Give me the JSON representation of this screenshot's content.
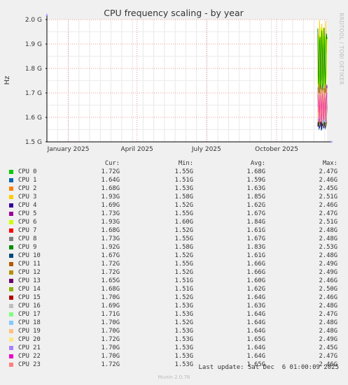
{
  "graph": {
    "side_label": "RRDTOOL / TOBI OETIKER",
    "last_update": "Last update: Sat Dec  6 01:00:09 2025",
    "footer": "Munin 2.0.76"
  },
  "chart_data": {
    "type": "line",
    "title": "CPU frequency scaling - by year",
    "ylabel": "Hz",
    "ylim": [
      1.5,
      2.0
    ],
    "yticks": [
      {
        "value": 2.0,
        "label": "2.0 G"
      },
      {
        "value": 1.9,
        "label": "1.9 G"
      },
      {
        "value": 1.8,
        "label": "1.8 G"
      },
      {
        "value": 1.7,
        "label": "1.7 G"
      },
      {
        "value": 1.6,
        "label": "1.6 G"
      },
      {
        "value": 1.5,
        "label": "1.5 G"
      }
    ],
    "xlim": [
      "2024-12-04",
      "2025-12-06"
    ],
    "xticks": [
      {
        "date": "2025-01-01",
        "label": "January 2025"
      },
      {
        "date": "2025-04-01",
        "label": "April 2025"
      },
      {
        "date": "2025-07-01",
        "label": "July 2025"
      },
      {
        "date": "2025-10-01",
        "label": "October 2025"
      }
    ],
    "data_start": "2025-11-24",
    "grid": true,
    "legend_headers": [
      "Cur:",
      "Min:",
      "Avg:",
      "Max:"
    ],
    "series": [
      {
        "name": "CPU 0",
        "color": "#00cc00",
        "cur": "1.72G",
        "min": "1.55G",
        "avg": "1.68G",
        "max": "2.47G"
      },
      {
        "name": "CPU 1",
        "color": "#0066b3",
        "cur": "1.64G",
        "min": "1.51G",
        "avg": "1.59G",
        "max": "2.46G"
      },
      {
        "name": "CPU 2",
        "color": "#ff8000",
        "cur": "1.68G",
        "min": "1.53G",
        "avg": "1.63G",
        "max": "2.45G"
      },
      {
        "name": "CPU 3",
        "color": "#ffcc00",
        "cur": "1.93G",
        "min": "1.58G",
        "avg": "1.85G",
        "max": "2.51G"
      },
      {
        "name": "CPU 4",
        "color": "#330099",
        "cur": "1.69G",
        "min": "1.52G",
        "avg": "1.62G",
        "max": "2.46G"
      },
      {
        "name": "CPU 5",
        "color": "#990099",
        "cur": "1.73G",
        "min": "1.55G",
        "avg": "1.67G",
        "max": "2.47G"
      },
      {
        "name": "CPU 6",
        "color": "#ccff00",
        "cur": "1.93G",
        "min": "1.60G",
        "avg": "1.84G",
        "max": "2.51G"
      },
      {
        "name": "CPU 7",
        "color": "#ff0000",
        "cur": "1.68G",
        "min": "1.52G",
        "avg": "1.61G",
        "max": "2.48G"
      },
      {
        "name": "CPU 8",
        "color": "#808080",
        "cur": "1.73G",
        "min": "1.55G",
        "avg": "1.67G",
        "max": "2.48G"
      },
      {
        "name": "CPU 9",
        "color": "#008f00",
        "cur": "1.92G",
        "min": "1.58G",
        "avg": "1.83G",
        "max": "2.53G"
      },
      {
        "name": "CPU 10",
        "color": "#00487d",
        "cur": "1.67G",
        "min": "1.52G",
        "avg": "1.61G",
        "max": "2.48G"
      },
      {
        "name": "CPU 11",
        "color": "#b35a00",
        "cur": "1.72G",
        "min": "1.55G",
        "avg": "1.66G",
        "max": "2.49G"
      },
      {
        "name": "CPU 12",
        "color": "#b38f00",
        "cur": "1.72G",
        "min": "1.52G",
        "avg": "1.66G",
        "max": "2.49G"
      },
      {
        "name": "CPU 13",
        "color": "#6b006b",
        "cur": "1.65G",
        "min": "1.51G",
        "avg": "1.60G",
        "max": "2.46G"
      },
      {
        "name": "CPU 14",
        "color": "#8fb300",
        "cur": "1.68G",
        "min": "1.51G",
        "avg": "1.62G",
        "max": "2.50G"
      },
      {
        "name": "CPU 15",
        "color": "#b30000",
        "cur": "1.70G",
        "min": "1.52G",
        "avg": "1.64G",
        "max": "2.46G"
      },
      {
        "name": "CPU 16",
        "color": "#bebebe",
        "cur": "1.69G",
        "min": "1.53G",
        "avg": "1.63G",
        "max": "2.48G"
      },
      {
        "name": "CPU 17",
        "color": "#80ff80",
        "cur": "1.71G",
        "min": "1.53G",
        "avg": "1.64G",
        "max": "2.47G"
      },
      {
        "name": "CPU 18",
        "color": "#80c9ff",
        "cur": "1.70G",
        "min": "1.52G",
        "avg": "1.64G",
        "max": "2.48G"
      },
      {
        "name": "CPU 19",
        "color": "#ffc080",
        "cur": "1.70G",
        "min": "1.53G",
        "avg": "1.64G",
        "max": "2.48G"
      },
      {
        "name": "CPU 20",
        "color": "#ffe680",
        "cur": "1.72G",
        "min": "1.53G",
        "avg": "1.65G",
        "max": "2.49G"
      },
      {
        "name": "CPU 21",
        "color": "#aa80ff",
        "cur": "1.70G",
        "min": "1.53G",
        "avg": "1.64G",
        "max": "2.45G"
      },
      {
        "name": "CPU 22",
        "color": "#ee00cc",
        "cur": "1.70G",
        "min": "1.53G",
        "avg": "1.64G",
        "max": "2.47G"
      },
      {
        "name": "CPU 23",
        "color": "#ff8080",
        "cur": "1.72G",
        "min": "1.53G",
        "avg": "1.65G",
        "max": "2.46G"
      }
    ]
  }
}
